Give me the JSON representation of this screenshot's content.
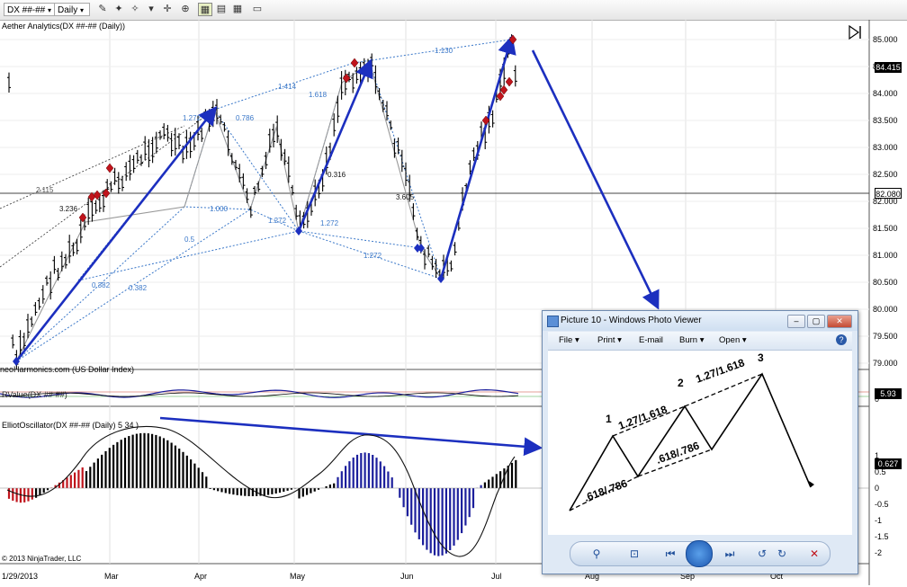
{
  "toolbar": {
    "instrument": "DX ##-##",
    "interval": "Daily",
    "icons": [
      "dropdown-icon",
      "pencil-icon",
      "magic-wand-icon",
      "crosshair-icon",
      "magnifier-icon",
      "color-grid-icon",
      "chart-properties-icon",
      "grid-icon",
      "data-box-icon"
    ]
  },
  "main_chart": {
    "title": "Aether Analytics(DX ##-## (Daily))",
    "watermark": "neoHarmonics.com (US Dollar Index)",
    "price_axis": [
      "85.000",
      "84.500",
      "84.000",
      "83.500",
      "83.000",
      "82.500",
      "82.000",
      "81.500",
      "81.000",
      "80.500",
      "80.000",
      "79.500",
      "79.000"
    ],
    "last_price": "84.415",
    "crosshair_price": "82.080",
    "ratios": [
      "1.130",
      "1.414",
      "1.618",
      "1.272",
      "0.786",
      "1.272",
      "1.000",
      "3.236",
      "2.115",
      "0.316",
      "3.605",
      "1.272",
      "1.272",
      "0.382",
      "0.382",
      "0.5"
    ],
    "ylim": [
      79.0,
      85.0
    ]
  },
  "rvalue_pane": {
    "label": "RValue(DX ##-##)",
    "value": "5.93",
    "axis": [
      "0"
    ]
  },
  "oscillator_pane": {
    "title": "ElliotOscillator(DX ##-## (Daily) 5 34 )",
    "axis": [
      "1",
      "0.5",
      "0",
      "-0.5",
      "-1",
      "-1.5",
      "-2"
    ],
    "current_value": "0.627"
  },
  "time_axis": {
    "start_date": "1/29/2013",
    "months": [
      "Mar",
      "Apr",
      "May",
      "Jun",
      "Jul",
      "Aug",
      "Sep",
      "Oct"
    ],
    "copyright": "© 2013 NinjaTrader, LLC"
  },
  "photo_viewer": {
    "title": "Picture 10 - Windows Photo Viewer",
    "menu": [
      "File",
      "Print",
      "E-mail",
      "Burn",
      "Open"
    ],
    "labels": {
      "wave1": "1",
      "wave2": "2",
      "wave3": "3",
      "ratio1": "1.27/1.618",
      "ratio2": "1.27/1.618",
      "ratio3": ".618/.786",
      "ratio4": ".618/.786"
    },
    "controls": [
      "zoom-icon",
      "fit-icon",
      "previous-icon",
      "slideshow-icon",
      "next-icon",
      "rotate-left-icon",
      "rotate-right-icon",
      "delete-icon"
    ]
  },
  "colors": {
    "accent_blue": "#1c2fbf",
    "fib_blue": "#3b78c9",
    "bull_red": "#c0141c",
    "osc_blue": "#1c1f9c",
    "viewer_frame": "#dfe9f5"
  }
}
